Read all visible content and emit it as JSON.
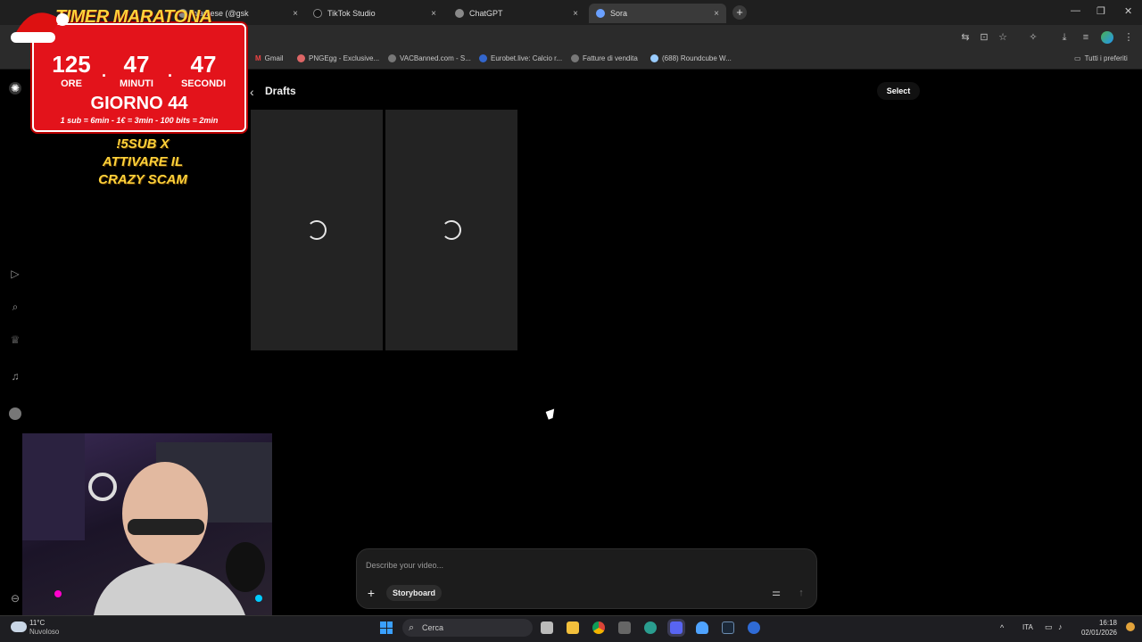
{
  "browser": {
    "tabs": [
      {
        "label": "hiantese (@gsk",
        "active": false
      },
      {
        "label": "TikTok Studio",
        "active": false
      },
      {
        "label": "ChatGPT",
        "active": false
      },
      {
        "label": "Sora",
        "active": true
      }
    ],
    "bookmarks": [
      "Gmail",
      "PNGEgg - Exclusive...",
      "VACBanned.com - S...",
      "Eurobet.live: Calcio r...",
      "Fatture di vendita",
      "(688) Roundcube W..."
    ],
    "all_bookmarks": "Tutti i preferiti"
  },
  "overlay": {
    "timer_title": "TIMER MARATONA",
    "hours": "125",
    "minutes": "47",
    "seconds": "47",
    "hours_label": "ORE",
    "minutes_label": "MINUTI",
    "seconds_label": "SECONDI",
    "day": "GIORNO 44",
    "rules": "1 sub = 6min - 1€ = 3min - 100 bits = 2min",
    "promo_line1": "!5SUB X",
    "promo_line2": "ATTIVARE IL",
    "promo_line3": "CRAZY SCAM"
  },
  "sora": {
    "page_title": "Drafts",
    "select_label": "Select",
    "drafts_loading": 2,
    "prompt_placeholder": "Describe your video...",
    "storyboard_label": "Storyboard"
  },
  "taskbar": {
    "weather_temp": "11°C",
    "weather_desc": "Nuvoloso",
    "search_label": "Cerca",
    "language": "ITA",
    "time": "16:18",
    "date": "02/01/2026"
  }
}
